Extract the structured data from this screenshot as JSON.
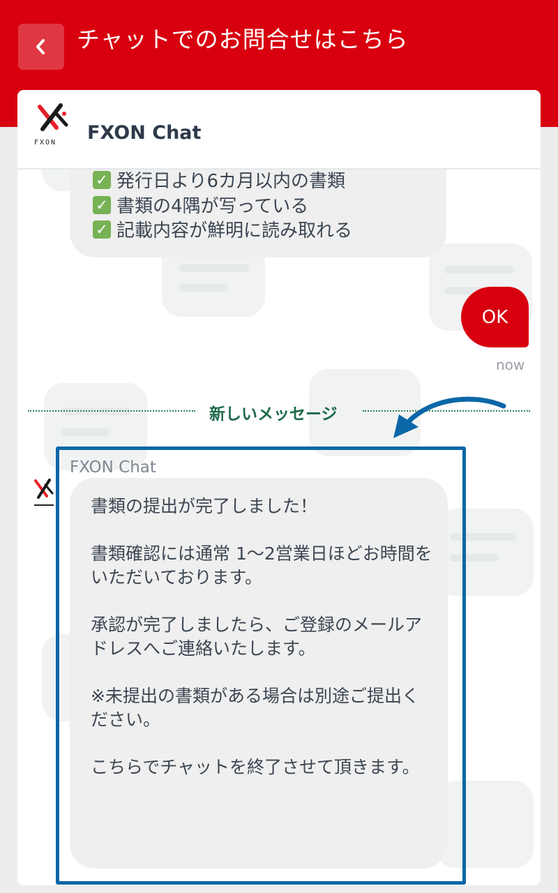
{
  "header": {
    "title": "チャットでのお問合せはこちら",
    "color": "#d8000f"
  },
  "chat": {
    "name": "FXON Chat",
    "logo_text": "FXON"
  },
  "messages": {
    "prev_checklist": [
      "発行日より6カ月以内の書類",
      "書類の4隅が写っている",
      "記載内容が鮮明に読み取れる"
    ],
    "user_reply": "OK",
    "user_reply_time": "now",
    "divider_label": "新しいメッセージ",
    "sender": "FXON Chat",
    "bot_paragraphs": [
      "書類の提出が完了しました！",
      "書類確認には通常 1～2営業日ほどお時間をいただいております。",
      "承認が完了しましたら、ご登録のメールアドレスへご連絡いたします。",
      "※未提出の書類がある場合は別途ご提出ください。",
      "こちらでチャットを終了させて頂きます。"
    ]
  },
  "icons": {
    "back": "chevron-left-icon",
    "check": "check-box-icon",
    "logo": "fxon-logo-icon"
  },
  "colors": {
    "brand_red": "#d8000f",
    "highlight_blue": "#0c67a8",
    "divider_green": "#1e6a4a"
  }
}
